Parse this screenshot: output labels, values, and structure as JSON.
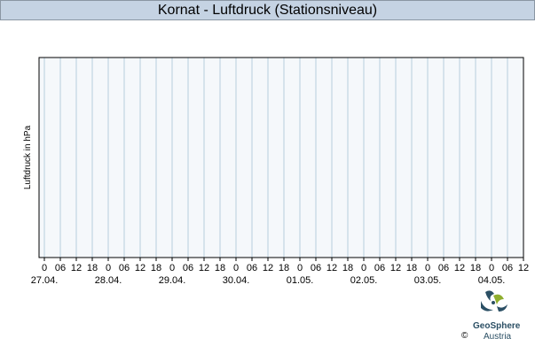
{
  "title": "Kornat - Luftdruck (Stationsniveau)",
  "chart_data": {
    "type": "line",
    "title": "Kornat - Luftdruck (Stationsniveau)",
    "ylabel": "Luftdruck in hPa",
    "xlabel": "",
    "hour_ticks": [
      "0",
      "06",
      "12",
      "18",
      "0",
      "06",
      "12",
      "18",
      "0",
      "06",
      "12",
      "18",
      "0",
      "06",
      "12",
      "18",
      "0",
      "06",
      "12",
      "18",
      "0",
      "06",
      "12",
      "18",
      "0",
      "06",
      "12",
      "18",
      "0",
      "06",
      "12"
    ],
    "date_labels": [
      "27.04.",
      "28.04.",
      "29.04.",
      "30.04.",
      "01.05.",
      "02.05.",
      "03.05.",
      "04.05."
    ],
    "series": [],
    "grid": true,
    "colors": {
      "plot_bg": "#f5f8fb",
      "grid": "#a9c3d6",
      "frame": "#000000",
      "title_bg": "#c5d3e3"
    }
  },
  "branding": {
    "name": "GeoSphere",
    "sub": "Austria",
    "copyright": "©"
  }
}
